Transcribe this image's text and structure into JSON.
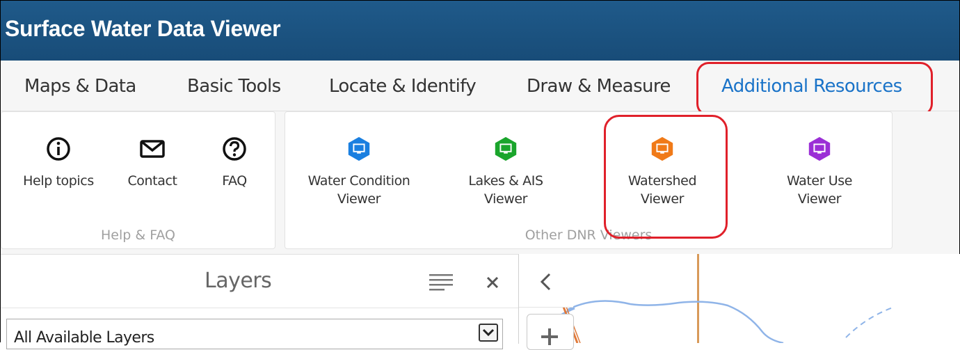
{
  "app": {
    "title": "Surface Water Data Viewer"
  },
  "tabs": [
    {
      "label": "Maps & Data"
    },
    {
      "label": "Basic Tools"
    },
    {
      "label": "Locate & Identify"
    },
    {
      "label": "Draw & Measure"
    },
    {
      "label": "Additional Resources",
      "active": true
    }
  ],
  "help_group": {
    "caption": "Help & FAQ",
    "tools": [
      {
        "label": "Help topics",
        "icon": "info-icon"
      },
      {
        "label": "Contact",
        "icon": "mail-icon"
      },
      {
        "label": "FAQ",
        "icon": "question-icon"
      }
    ]
  },
  "viewers_group": {
    "caption": "Other DNR Viewers",
    "tools": [
      {
        "label_line1": "Water Condition",
        "label_line2": "Viewer",
        "icon": "monitor-icon",
        "color": "#1a7fe0"
      },
      {
        "label_line1": "Lakes & AIS",
        "label_line2": "Viewer",
        "icon": "monitor-icon",
        "color": "#1aa52c"
      },
      {
        "label_line1": "Watershed",
        "label_line2": "Viewer",
        "icon": "monitor-icon",
        "color": "#f07a18"
      },
      {
        "label_line1": "Water Use",
        "label_line2": "Viewer",
        "icon": "monitor-icon",
        "color": "#9b2fd6"
      }
    ]
  },
  "layers": {
    "title": "Layers",
    "select_value": "All Available Layers"
  },
  "colors": {
    "header": "#1f5a8a",
    "active_tab": "#1a73c8",
    "highlight": "#e0202a"
  }
}
